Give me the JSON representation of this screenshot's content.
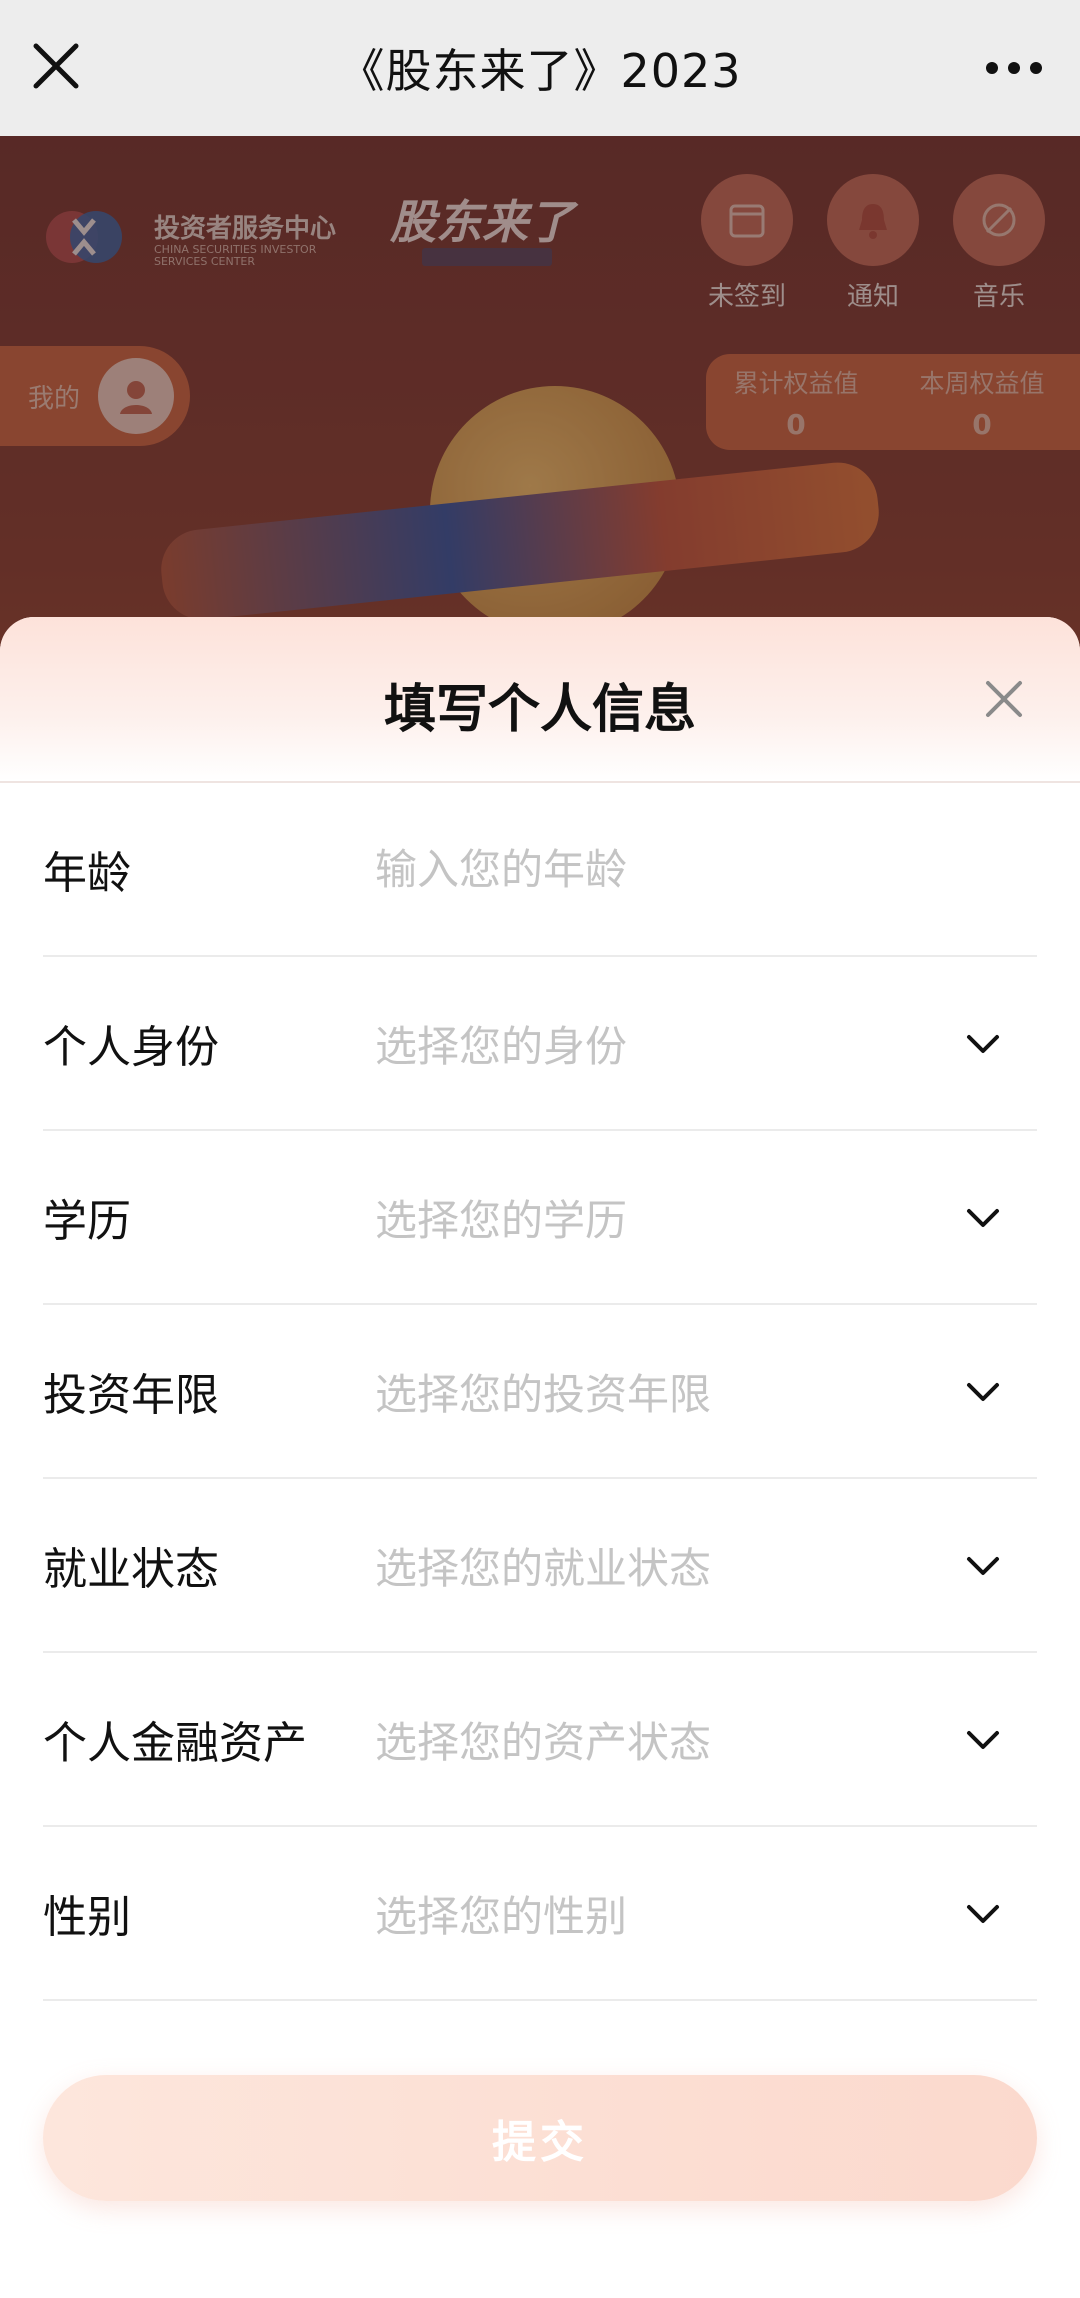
{
  "nav": {
    "title": "《股东来了》2023",
    "close_icon": "close-icon",
    "more_icon": "more-icon"
  },
  "background": {
    "logo_text": "投资者服务中心",
    "logo_sub": "CHINA SECURITIES INVESTOR SERVICES CENTER",
    "brand": "股东来了",
    "buttons": [
      {
        "label": "未签到",
        "icon": "checkin-icon"
      },
      {
        "label": "通知",
        "icon": "bell-icon"
      },
      {
        "label": "音乐",
        "icon": "music-off-icon"
      }
    ],
    "mine_label": "我的",
    "stats": [
      {
        "title": "累计权益值",
        "value": "0"
      },
      {
        "title": "本周权益值",
        "value": "0"
      }
    ]
  },
  "sheet": {
    "title": "填写个人信息",
    "rows": [
      {
        "label": "年龄",
        "placeholder": "输入您的年龄"
      },
      {
        "label": "个人身份",
        "placeholder": "选择您的身份"
      },
      {
        "label": "学历",
        "placeholder": "选择您的学历"
      },
      {
        "label": "投资年限",
        "placeholder": "选择您的投资年限"
      },
      {
        "label": "就业状态",
        "placeholder": "选择您的就业状态"
      },
      {
        "label": "个人金融资产",
        "placeholder": "选择您的资产状态"
      },
      {
        "label": "性别",
        "placeholder": "选择您的性别"
      }
    ],
    "submit_label": "提交"
  },
  "colors": {
    "accent": "#fbd9cd",
    "nav_bg": "#ededed",
    "placeholder": "#c4c4c4"
  }
}
